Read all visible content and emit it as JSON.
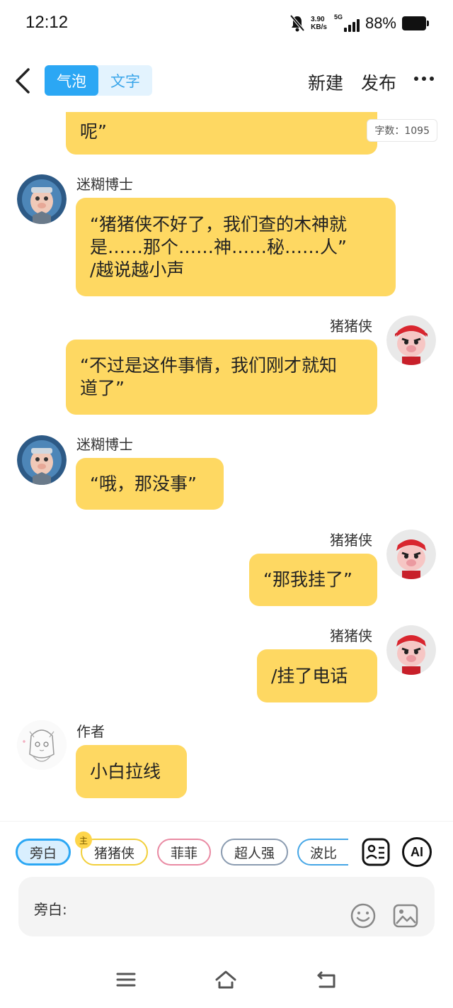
{
  "status": {
    "time": "12:12",
    "speed_value": "3.90",
    "speed_unit": "KB/s",
    "network": "5G",
    "battery": "88%"
  },
  "header": {
    "tabs": [
      {
        "label": "气泡"
      },
      {
        "label": "文字"
      }
    ],
    "new_label": "新建",
    "publish_label": "发布"
  },
  "word_count": "字数：1095",
  "messages": [
    {
      "speaker": "",
      "text": "“有什么事快说，我还要被指中呢”",
      "visible_text": "呢”",
      "side": "right"
    },
    {
      "speaker": "迷糊博士",
      "text": "“猪猪侠不好了，我们查的木神就\n是……那个……神……秘……人”\n/越说越小声",
      "side": "left"
    },
    {
      "speaker": "猪猪侠",
      "text": "“不过是这件事情，我们刚才就知\n道了”",
      "side": "right"
    },
    {
      "speaker": "迷糊博士",
      "text": "“哦，那没事”",
      "side": "left"
    },
    {
      "speaker": "猪猪侠",
      "text": "“那我挂了”",
      "side": "right"
    },
    {
      "speaker": "猪猪侠",
      "text": "/挂了电话",
      "side": "right"
    },
    {
      "speaker": "作者",
      "text": "小白拉线",
      "side": "left"
    }
  ],
  "roles": [
    {
      "label": "旁白",
      "color": "#2ba7f4",
      "selected": true
    },
    {
      "label": "猪猪侠",
      "color": "#f2cf3a",
      "badge": "主"
    },
    {
      "label": "菲菲",
      "color": "#e98aa3"
    },
    {
      "label": "超人强",
      "color": "#8a9bb0"
    },
    {
      "label": "波比",
      "color": "#45a6e6"
    }
  ],
  "tools": {
    "ai_label": "AI"
  },
  "input": {
    "label": "旁白:",
    "value": ""
  },
  "icons": [
    "bell-mute-icon",
    "back-icon",
    "more-icon",
    "role-card-icon",
    "ai-icon",
    "emoji-icon",
    "image-icon",
    "menu-icon",
    "home-icon",
    "return-icon"
  ]
}
